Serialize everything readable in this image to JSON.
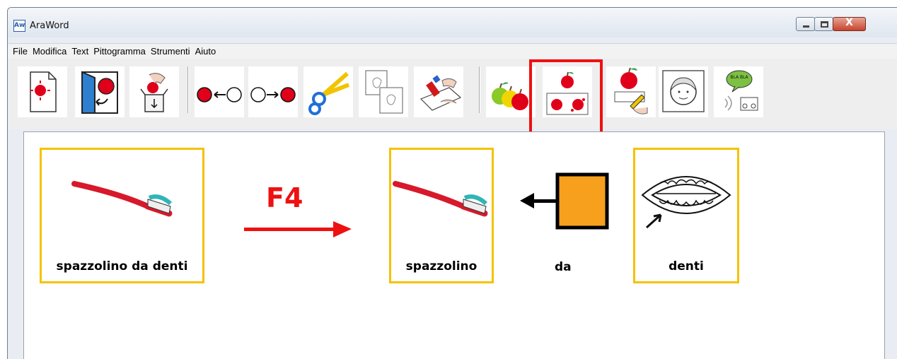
{
  "window": {
    "title": "AraWord",
    "icon_text": "Aw",
    "close_glyph": "X"
  },
  "menu": [
    "File",
    "Modifica",
    "Text",
    "Pittogramma",
    "Strumenti",
    "Aiuto"
  ],
  "toolbar": {
    "tools": [
      {
        "name": "new-document-icon"
      },
      {
        "name": "open-document-icon"
      },
      {
        "name": "save-document-icon"
      },
      {
        "name": "left-arrow-pictogram-icon"
      },
      {
        "name": "right-arrow-pictogram-icon"
      },
      {
        "name": "scissors-icon"
      },
      {
        "name": "copy-pictogram-icon"
      },
      {
        "name": "paste-glue-icon"
      },
      {
        "name": "apples-icon"
      },
      {
        "name": "split-pictogram-icon",
        "highlighted": true
      },
      {
        "name": "edit-pictogram-icon"
      },
      {
        "name": "face-icon"
      },
      {
        "name": "speech-icon"
      }
    ],
    "speech_text": "BLA BLA"
  },
  "annotation": {
    "key": "F4",
    "color": "#ee1111"
  },
  "cards": [
    {
      "label": "spazzolino da denti"
    },
    {
      "label": "spazzolino"
    },
    {
      "label": "da"
    },
    {
      "label": "denti"
    }
  ],
  "colors": {
    "card_border": "#f5c200",
    "highlight": "#ee1111",
    "square_fill": "#f7a01e"
  }
}
